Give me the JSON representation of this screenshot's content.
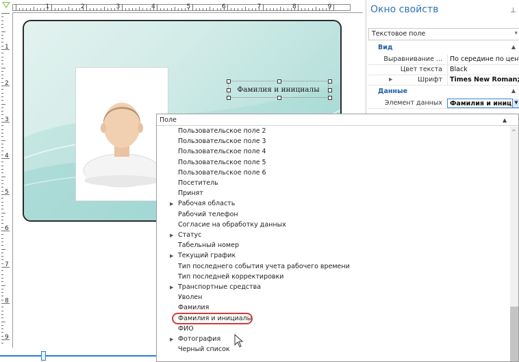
{
  "ruler": {
    "h_numbers": [
      "1",
      "2",
      "3",
      "4",
      "5",
      "6",
      "7",
      "8",
      "9"
    ],
    "v_numbers": [
      "1",
      "2",
      "3",
      "4",
      "5",
      "6",
      "7",
      "8",
      "9"
    ]
  },
  "card": {
    "text_field_value": "Фамилия и инициалы",
    "colors": {
      "card_bg": "#c4e6e2",
      "border": "#2a2a2a"
    }
  },
  "properties": {
    "title": "Окно свойств",
    "pin_icon": "pin-icon",
    "object_select": "Текстовое поле",
    "categories": [
      {
        "label": "Вид",
        "rows": [
          {
            "name": "Выравнивание ...",
            "value": "По середине по центру"
          },
          {
            "name": "Цвет текста",
            "value": "Black"
          },
          {
            "name": "Шрифт",
            "value": "Times New Roman; ..."
          }
        ]
      },
      {
        "label": "Данные",
        "rows": [
          {
            "name": "Элемент данных",
            "value": "Фамилия и иниц..."
          }
        ]
      }
    ]
  },
  "dropdown": {
    "header": "Поле",
    "items": [
      {
        "label": "Пользовательское поле 2",
        "expandable": false
      },
      {
        "label": "Пользовательское поле 3",
        "expandable": false
      },
      {
        "label": "Пользовательское поле 4",
        "expandable": false
      },
      {
        "label": "Пользовательское поле 5",
        "expandable": false
      },
      {
        "label": "Пользовательское поле 6",
        "expandable": false
      },
      {
        "label": "Посетитель",
        "expandable": false
      },
      {
        "label": "Принят",
        "expandable": false
      },
      {
        "label": "Рабочая область",
        "expandable": true
      },
      {
        "label": "Рабочий телефон",
        "expandable": false
      },
      {
        "label": "Согласие на обработку данных",
        "expandable": false
      },
      {
        "label": "Статус",
        "expandable": true
      },
      {
        "label": "Табельный номер",
        "expandable": false
      },
      {
        "label": "Текущий график",
        "expandable": true
      },
      {
        "label": "Тип последнего события учета рабочего времени",
        "expandable": false
      },
      {
        "label": "Тип последней корректировки",
        "expandable": false
      },
      {
        "label": "Транспортные средства",
        "expandable": true
      },
      {
        "label": "Уволен",
        "expandable": false
      },
      {
        "label": "Фамилия",
        "expandable": false
      },
      {
        "label": "Фамилия и инициалы",
        "expandable": false,
        "highlighted": true
      },
      {
        "label": "ФИО",
        "expandable": false
      },
      {
        "label": "Фотография",
        "expandable": true
      },
      {
        "label": "Черный список",
        "expandable": false
      }
    ]
  },
  "colors": {
    "accent": "#2e74b5",
    "category": "#1f5fa8",
    "highlight_ring": "#d13b3b",
    "slider": "#2b7bd6"
  }
}
